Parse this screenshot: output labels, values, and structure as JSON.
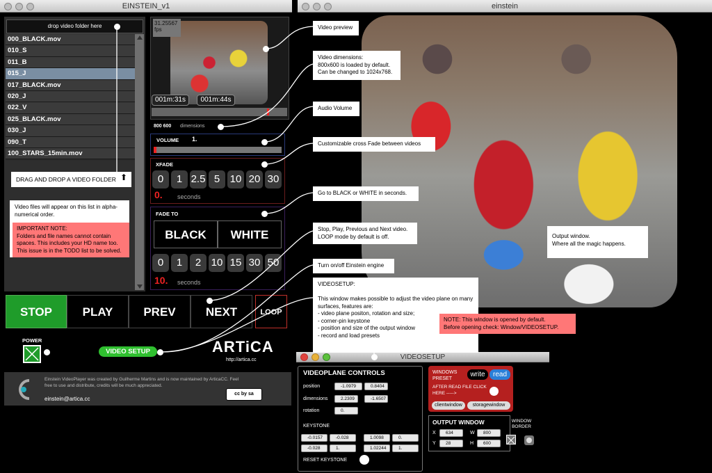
{
  "left_window": {
    "title": "EINSTEIN_v1",
    "drop_label": "drop video folder here",
    "files": [
      "000_BLACK.mov",
      "010_S",
      "011_B",
      "015_J",
      "017_BLACK.mov",
      "020_J",
      "022_V",
      "025_BLACK.mov",
      "030_J",
      "090_T",
      "100_STARS_15min.mov"
    ],
    "selected_index": 3,
    "drag_callout": "DRAG AND DROP A VIDEO FOLDER",
    "list_info": "Video files will appear on this list in alpha-numerical order.",
    "important_note": "IMPORTANT NOTE:\nFolders and file names cannot contain spaces. This includes your HD name too. This issue is in the TODO list to be solved.",
    "fps": "31.25567",
    "fps_unit": "fps",
    "time_current": "001m:31s",
    "time_total": "001m:44s",
    "dimensions_value": "800 600",
    "dimensions_label": "dimensions",
    "volume_label": "VOLUME",
    "volume_value": "1.",
    "xfade_label": "XFADE",
    "xfade_options": [
      "0",
      "1",
      "2.5",
      "5",
      "10",
      "20",
      "30"
    ],
    "xfade_value": "0.",
    "seconds_label": "seconds",
    "fadeto_label": "FADE TO",
    "black_label": "BLACK",
    "white_label": "WHITE",
    "fade_options": [
      "0",
      "1",
      "2",
      "10",
      "15",
      "30",
      "50"
    ],
    "fade_value": "10.",
    "stop_label": "STOP",
    "play_label": "PLAY",
    "prev_label": "PREV",
    "next_label": "NEXT",
    "loop_label": "LOOP",
    "power_label": "POWER",
    "video_setup_label": "VIDEO SETUP",
    "artica_logo": "ARTiCA",
    "artica_url": "http://artica.cc",
    "footer_text": "Einstein VideoPlayer was created by Guilherme Martins and is now maintained by ArticaCC. Feel free to use and distribute, credits will be much appreciated.",
    "footer_email": "einstein@artica.cc",
    "cc_label": "cc by sa"
  },
  "right_window": {
    "title": "einstein"
  },
  "callouts": {
    "preview": "Video preview",
    "dimensions": "Video dimensions:\n800x600 is loaded by default.\nCan be changed to 1024x768.",
    "audio": "Audio Volume",
    "xfade": "Customizable cross Fade between videos",
    "blackwhite": "Go to BLACK or WHITE in seconds.",
    "transport": "Stop, Play, Previous and Next video.\nLOOP mode by default is off.",
    "engine": "Turn on/off Einstein engine",
    "videosetup": "VIDEOSETUP:\n\nThis window makes possible to adjust the video plane on many surfaces, features are:\n- video plane positon, rotation and size;\n- corner-pin keystone\n- position and size of the output window\n- record and load presets",
    "videosetup_note": "NOTE: This window is opened by default.\nBefore opening check:  Window/VIDEOSETUP.",
    "output": "Output window.\nWhere all the magic happens."
  },
  "videosetup": {
    "title": "VIDEOSETUP",
    "controls_title": "VIDEOPLANE CONTROLS",
    "position_label": "position",
    "position_x": "-1.0979",
    "position_y": "0.8404",
    "dimensions_label": "dimensions",
    "dim_x": "2.2309",
    "dim_y": "-1.6507",
    "rotation_label": "rotation",
    "rotation_value": "0.",
    "keystone_label": "KEYSTONE",
    "keystone": [
      "-0.0157",
      "-0.028",
      "1.0098",
      "0.",
      "-0.028",
      "1.",
      "1.02244",
      "1."
    ],
    "reset_keystone": "RESET KEYSTONE",
    "presets_label": "WINDOWS PRESET",
    "write_label": "write",
    "read_label": "read",
    "after_read": "AFTER READ FILE CLICK HERE ----->",
    "clientwindow": "clientwindow",
    "storagewindow": "storagewindow",
    "output_title": "OUTPUT WINDOW",
    "x_label": "X",
    "x_value": "634",
    "y_label": "Y",
    "y_value": "28",
    "w_label": "W",
    "w_value": "800",
    "h_label": "H",
    "h_value": "600",
    "border_label": "WINDOW BORDER"
  },
  "colors": {
    "stop_green": "#1f9c2a",
    "setup_green": "#2fbf2f",
    "loop_red": "#c0302a",
    "note_red": "#f77",
    "preset_red": "#b5201f",
    "read_blue": "#2a7fd8"
  }
}
